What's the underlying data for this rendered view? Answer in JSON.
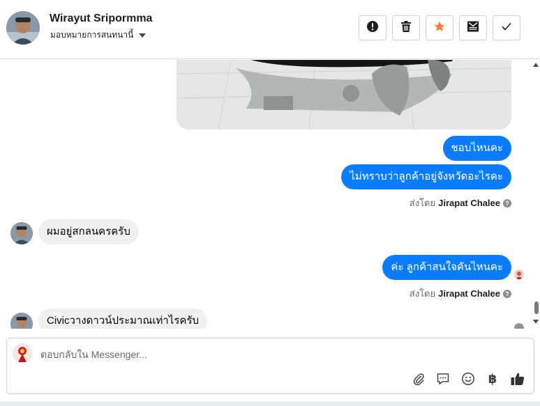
{
  "header": {
    "contact_name": "Wirayut Sripormma",
    "assign_label": "มอบหมายการสนทนานี้",
    "toolbar": {
      "spam": "exclamation-icon",
      "delete": "trash-icon",
      "star": "star-icon",
      "unread": "mark-unread-icon",
      "done": "check-icon"
    },
    "star_color": "#f5832b"
  },
  "messages": [
    {
      "side": "out",
      "text": "ชอบไหนคะ"
    },
    {
      "side": "out",
      "text": "ไม่ทราบว่าลูกค้าอยู่จังหวัดอะไรคะ"
    },
    {
      "side": "meta",
      "prefix": "ส่งโดย",
      "agent": "Jirapat Chalee"
    },
    {
      "side": "in",
      "text": "ผมอยู่สกลนครครับ"
    },
    {
      "side": "out",
      "text": "ค่ะ ลูกค้าสนใจคันไหนคะ"
    },
    {
      "side": "meta",
      "prefix": "ส่งโดย",
      "agent": "Jirapat Chalee"
    },
    {
      "side": "in",
      "text": "Civicวางดาวน์ประมาณเท่าไรครับ"
    }
  ],
  "composer": {
    "placeholder": "ตอบกลับใน Messenger...",
    "icons": [
      "paperclip-icon",
      "speech-bubble-icon",
      "smiley-icon",
      "baht-icon",
      "thumbs-up-icon"
    ],
    "baht_glyph": "฿"
  },
  "colors": {
    "outgoing": "#0a7cff",
    "incoming": "#f0f0f0"
  }
}
